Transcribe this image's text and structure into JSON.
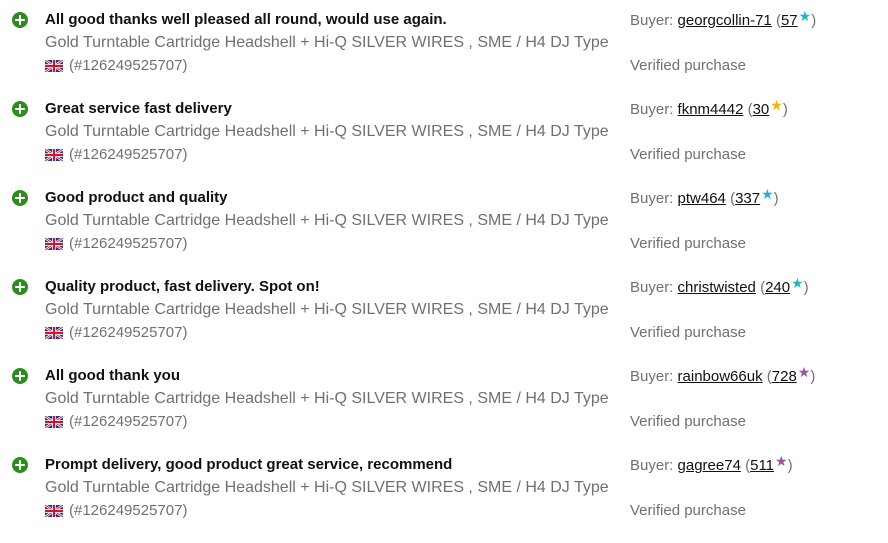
{
  "colors": {
    "positive_icon": "#2e8b1f",
    "muted_text": "#707070",
    "primary_text": "#111111",
    "star_teal": "#24b4c8",
    "star_yellow": "#f2b300",
    "star_purple": "#a54ca8"
  },
  "icons": {
    "positive": "plus-circle-icon",
    "flag": "uk-flag-icon",
    "star": "star-icon"
  },
  "labels": {
    "buyer_prefix": "Buyer:",
    "verified": "Verified purchase"
  },
  "feedback": [
    {
      "comment": "All good thanks well pleased all round, would use again.",
      "item_title": "Gold Turntable Cartridge Headshell + Hi-Q SILVER WIRES , SME / H4 DJ Type",
      "item_number": "(#126249525707)",
      "buyer_name": "georgcollin-71",
      "score": "57",
      "star_glyph": "★",
      "star_color": "#24b4c8"
    },
    {
      "comment": "Great service fast delivery",
      "item_title": "Gold Turntable Cartridge Headshell + Hi-Q SILVER WIRES , SME / H4 DJ Type",
      "item_number": "(#126249525707)",
      "buyer_name": "fknm4442",
      "score": "30",
      "star_glyph": "★",
      "star_color": "#f2b300"
    },
    {
      "comment": "Good product and quality",
      "item_title": "Gold Turntable Cartridge Headshell + Hi-Q SILVER WIRES , SME / H4 DJ Type",
      "item_number": "(#126249525707)",
      "buyer_name": "ptw464",
      "score": "337",
      "star_glyph": "★",
      "star_color": "#24b4c8"
    },
    {
      "comment": "Quality product, fast delivery. Spot on!",
      "item_title": "Gold Turntable Cartridge Headshell + Hi-Q SILVER WIRES , SME / H4 DJ Type",
      "item_number": "(#126249525707)",
      "buyer_name": "christwisted",
      "score": "240",
      "star_glyph": "★",
      "star_color": "#24b4c8"
    },
    {
      "comment": "All good thank you",
      "item_title": "Gold Turntable Cartridge Headshell + Hi-Q SILVER WIRES , SME / H4 DJ Type",
      "item_number": "(#126249525707)",
      "buyer_name": "rainbow66uk",
      "score": "728",
      "star_glyph": "★",
      "star_color": "#a54ca8"
    },
    {
      "comment": "Prompt delivery, good product great service, recommend",
      "item_title": "Gold Turntable Cartridge Headshell + Hi-Q SILVER WIRES , SME / H4 DJ Type",
      "item_number": "(#126249525707)",
      "buyer_name": "gagree74",
      "score": "511",
      "star_glyph": "★",
      "star_color": "#a54ca8"
    }
  ]
}
